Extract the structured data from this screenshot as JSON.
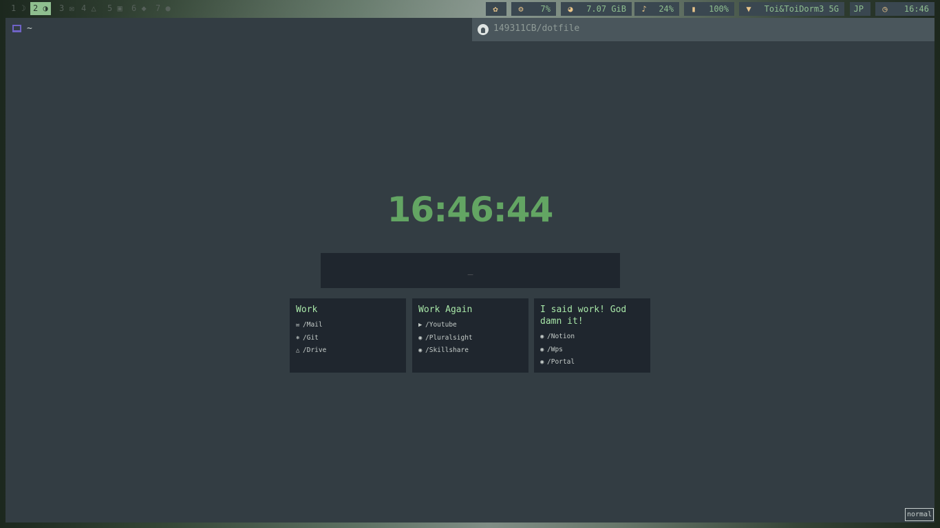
{
  "topbar": {
    "workspaces": [
      {
        "label": "1",
        "icon": "☽"
      },
      {
        "label": "2",
        "icon": "◑"
      },
      {
        "label": "3",
        "icon": "✉"
      },
      {
        "label": "4",
        "icon": "△"
      },
      {
        "label": "5",
        "icon": "▣"
      },
      {
        "label": "6",
        "icon": "◆"
      },
      {
        "label": "7",
        "icon": "●"
      }
    ],
    "modules": {
      "palette_icon": "✿",
      "cpu_icon": "⚙",
      "cpu": "7%",
      "memory_icon": "◕",
      "memory": "7.07 GiB",
      "volume_icon": "♪",
      "volume": "24%",
      "battery_icon": "▮",
      "battery": "100%",
      "wifi_icon": "▼",
      "wifi": "Toi&ToiDorm3 5G",
      "keyboard": "JP",
      "clock_icon": "◷",
      "time": "16:46"
    },
    "accent": "#8fbf8f"
  },
  "window": {
    "terminal_path": "~",
    "github_repo": "149311CB/dotfile"
  },
  "startpage": {
    "clock": "16:46:44",
    "search_placeholder": "_",
    "cards": [
      {
        "title": "Work",
        "links": [
          {
            "icon": "✉",
            "label": "/Mail"
          },
          {
            "icon": "⎈",
            "label": "/Git"
          },
          {
            "icon": "△",
            "label": "/Drive"
          }
        ]
      },
      {
        "title": "Work Again",
        "links": [
          {
            "icon": "▶",
            "label": "/Youtube"
          },
          {
            "icon": "◉",
            "label": "/Pluralsight"
          },
          {
            "icon": "◉",
            "label": "/Skillshare"
          }
        ]
      },
      {
        "title": "I said work! God damn it!",
        "links": [
          {
            "icon": "◉",
            "label": "/Notion"
          },
          {
            "icon": "◉",
            "label": "/Wps"
          },
          {
            "icon": "◉",
            "label": "/Portal"
          }
        ]
      }
    ]
  },
  "statusline": {
    "mode": "normal"
  }
}
